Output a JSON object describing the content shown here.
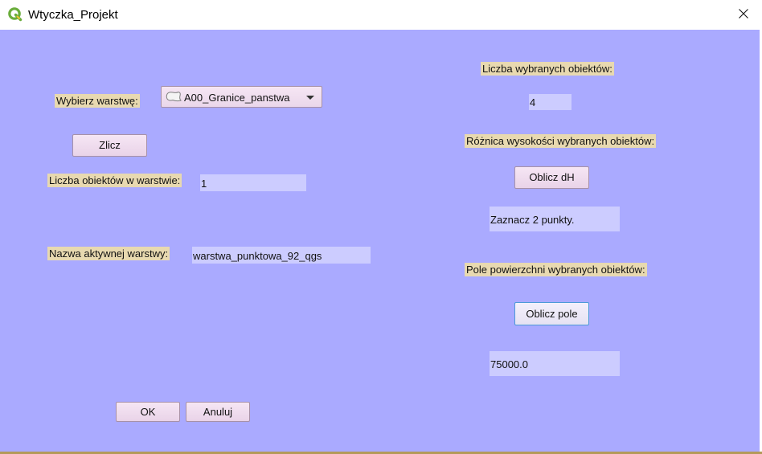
{
  "window": {
    "title": "Wtyczka_Projekt"
  },
  "left": {
    "layer_label": "Wybierz warstwę:",
    "layer_combo_value": "A00_Granice_panstwa",
    "count_button": "Zlicz",
    "objects_count_label": "Liczba obiektów w warstwie:",
    "objects_count_value": "1",
    "active_layer_label": "Nazwa aktywnej warstwy:",
    "active_layer_value": "warstwa_punktowa_92_qgs"
  },
  "right": {
    "selected_count_label": "Liczba wybranych obiektów:",
    "selected_count_value": "4",
    "height_diff_label": "Różnica wysokości wybranych obiektów:",
    "height_diff_button": "Oblicz dH",
    "height_diff_result": "Zaznacz 2 punkty.",
    "area_label": "Pole powierzchni wybranych obiektów:",
    "area_button": "Oblicz pole",
    "area_result": "75000.0"
  },
  "footer": {
    "ok_label": "OK",
    "cancel_label": "Anuluj"
  },
  "icons": {
    "app": "qgis-logo-icon",
    "close": "close-icon",
    "layer": "polygon-layer-icon",
    "dropdown": "chevron-down-icon"
  },
  "colors": {
    "client_background": "#aaaaff",
    "label_background": "#e8d9b0",
    "field_background": "#ccccff",
    "button_background": "#f0e0ef",
    "qgis_green": "#6aad3b",
    "qgis_yellow": "#f2c230"
  }
}
